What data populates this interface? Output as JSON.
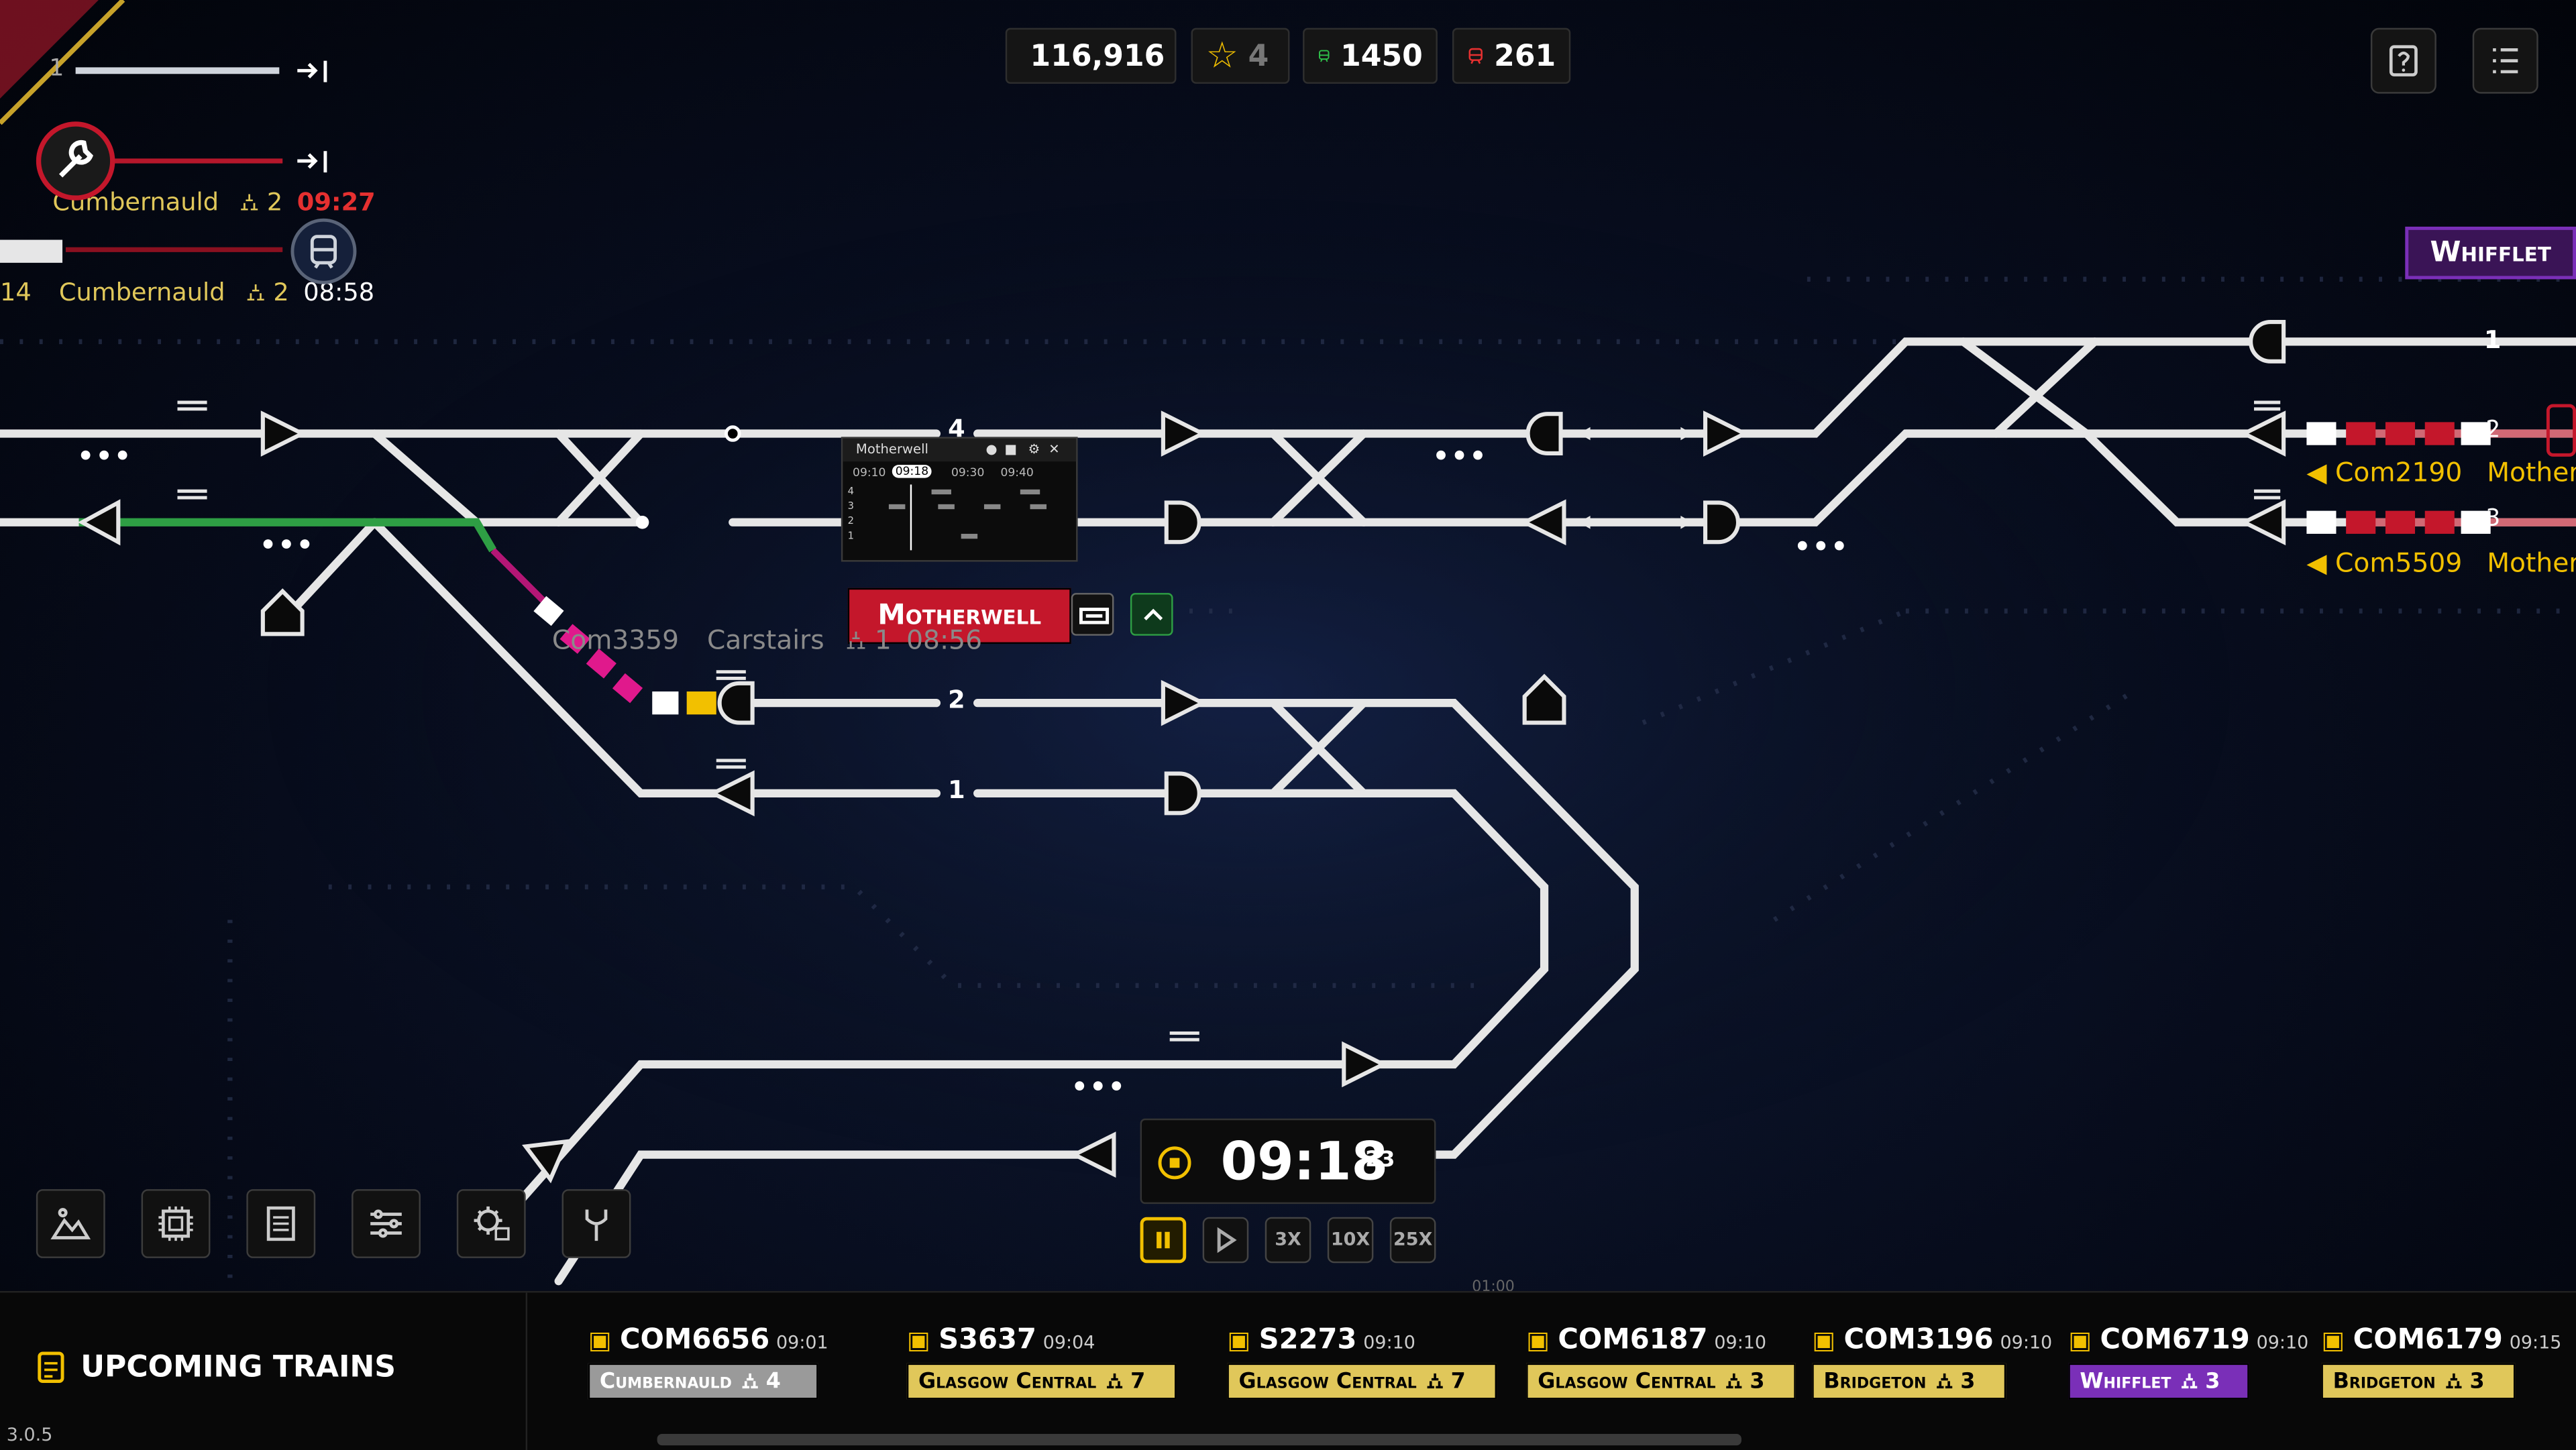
{
  "resources": {
    "money": "116,916",
    "stars": "4",
    "trains_on_time": "1450",
    "trains_late": "261"
  },
  "stations": {
    "motherwell": "Motherwell",
    "whifflet": "Whifflet"
  },
  "platforms": [
    "4",
    "2",
    "1"
  ],
  "right_track_number": "1",
  "timetable_popup": {
    "title": "Motherwell",
    "times": [
      "09:10",
      "09:18",
      "09:30",
      "09:40"
    ],
    "rows": [
      "4",
      "3",
      "2",
      "1"
    ]
  },
  "left_trains": [
    {
      "number": "1"
    },
    {
      "dest": "Cumbernauld",
      "platform": "2",
      "time": "09:27"
    },
    {
      "num": "14",
      "dest": "Cumbernauld",
      "platform": "2",
      "time": "08:58"
    }
  ],
  "track_trains": [
    {
      "id": "Com3359",
      "dest": "Carstairs",
      "platform": "1",
      "time": "08:56"
    }
  ],
  "right_trains": [
    {
      "id": "Com2190",
      "dest": "Mother",
      "track": "2"
    },
    {
      "id": "Com5509",
      "dest": "Mother",
      "track": "3"
    }
  ],
  "clock": {
    "time": "09:18",
    "seconds": "23",
    "scale_label": "01:00"
  },
  "speed_buttons": [
    "3X",
    "10X",
    "25X"
  ],
  "upcoming": {
    "title": "UPCOMING TRAINS",
    "trains": [
      {
        "code": "COM6656",
        "time": "09:01",
        "dest": "Cumbernauld",
        "platform": "4",
        "color": "#9a9a9a"
      },
      {
        "code": "S3637",
        "time": "09:04",
        "dest": "Glasgow Central",
        "platform": "7",
        "color": "#e0c75a"
      },
      {
        "code": "S2273",
        "time": "09:10",
        "dest": "Glasgow Central",
        "platform": "7",
        "color": "#e0c75a"
      },
      {
        "code": "COM6187",
        "time": "09:10",
        "dest": "Glasgow Central",
        "platform": "3",
        "color": "#e0c75a"
      },
      {
        "code": "COM3196",
        "time": "09:10",
        "dest": "Bridgeton",
        "platform": "3",
        "color": "#e0c75a"
      },
      {
        "code": "COM6719",
        "time": "09:10",
        "dest": "Whifflet",
        "platform": "3",
        "color": "#7a2fb8"
      },
      {
        "code": "COM6179",
        "time": "09:15",
        "dest": "Bridgeton",
        "platform": "3",
        "color": "#e0c75a"
      }
    ]
  },
  "version": "3.0.5",
  "colors": {
    "accent_yellow": "#f2c000",
    "signal_red": "#c4172b",
    "route_green": "#2e9e44",
    "train_magenta": "#e0198c"
  }
}
